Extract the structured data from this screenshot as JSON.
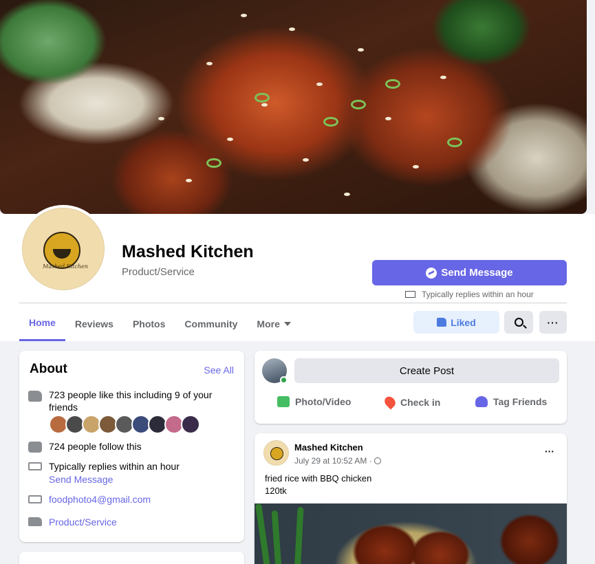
{
  "page": {
    "name": "Mashed Kitchen",
    "category": "Product/Service",
    "logo_text": "Mashed Kitchen"
  },
  "actions": {
    "send_message": "Send Message",
    "reply_note": "Typically replies within an hour",
    "liked": "Liked"
  },
  "tabs": [
    "Home",
    "Reviews",
    "Photos",
    "Community",
    "More"
  ],
  "about": {
    "title": "About",
    "see_all": "See All",
    "likes": "723 people like this including 9 of your friends",
    "follows": "724 people follow this",
    "replies": "Typically replies within an hour",
    "send_message_link": "Send Message",
    "email": "foodphoto4@gmail.com",
    "category_link": "Product/Service"
  },
  "friend_colors": [
    "#b86b3e",
    "#4a4a4a",
    "#c9a46a",
    "#7c5a3a",
    "#5a5a5a",
    "#3b4b7a",
    "#2b2b3a",
    "#c46a8a",
    "#3a2b4a"
  ],
  "create_post": {
    "button": "Create Post",
    "photo_video": "Photo/Video",
    "check_in": "Check in",
    "tag_friends": "Tag Friends"
  },
  "post": {
    "author": "Mashed Kitchen",
    "time": "July 29 at 10:52 AM ·",
    "text_line1": "fried rice with BBQ chicken",
    "text_line2": "120tk",
    "more": "···"
  },
  "colors": {
    "accent": "#6766e6",
    "liked_bg": "#e7f0fd",
    "liked_text": "#4c7be0"
  }
}
